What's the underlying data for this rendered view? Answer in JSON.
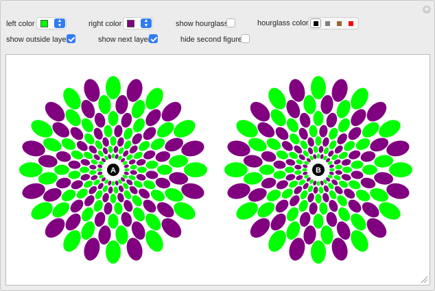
{
  "controls": {
    "left_color": {
      "label": "left color",
      "value": "#00ff00"
    },
    "right_color": {
      "label": "right color",
      "value": "#800080"
    },
    "show_hourglass": {
      "label": "show hourglass",
      "checked": false
    },
    "hourglass_color": {
      "label": "hourglass color",
      "options": [
        "#000000",
        "#808080",
        "#996633",
        "#ff0000"
      ],
      "selected": 0
    },
    "show_outside_layer": {
      "label": "show outside layer",
      "checked": true
    },
    "show_next_layer": {
      "label": "show next layer",
      "checked": true
    },
    "hide_second_figure": {
      "label": "hide second figure",
      "checked": false
    }
  },
  "figures": [
    {
      "center_label": "A"
    },
    {
      "center_label": "B"
    }
  ],
  "icons": {
    "add": "plus-circle-icon",
    "resize": "resize-grip-icon"
  }
}
